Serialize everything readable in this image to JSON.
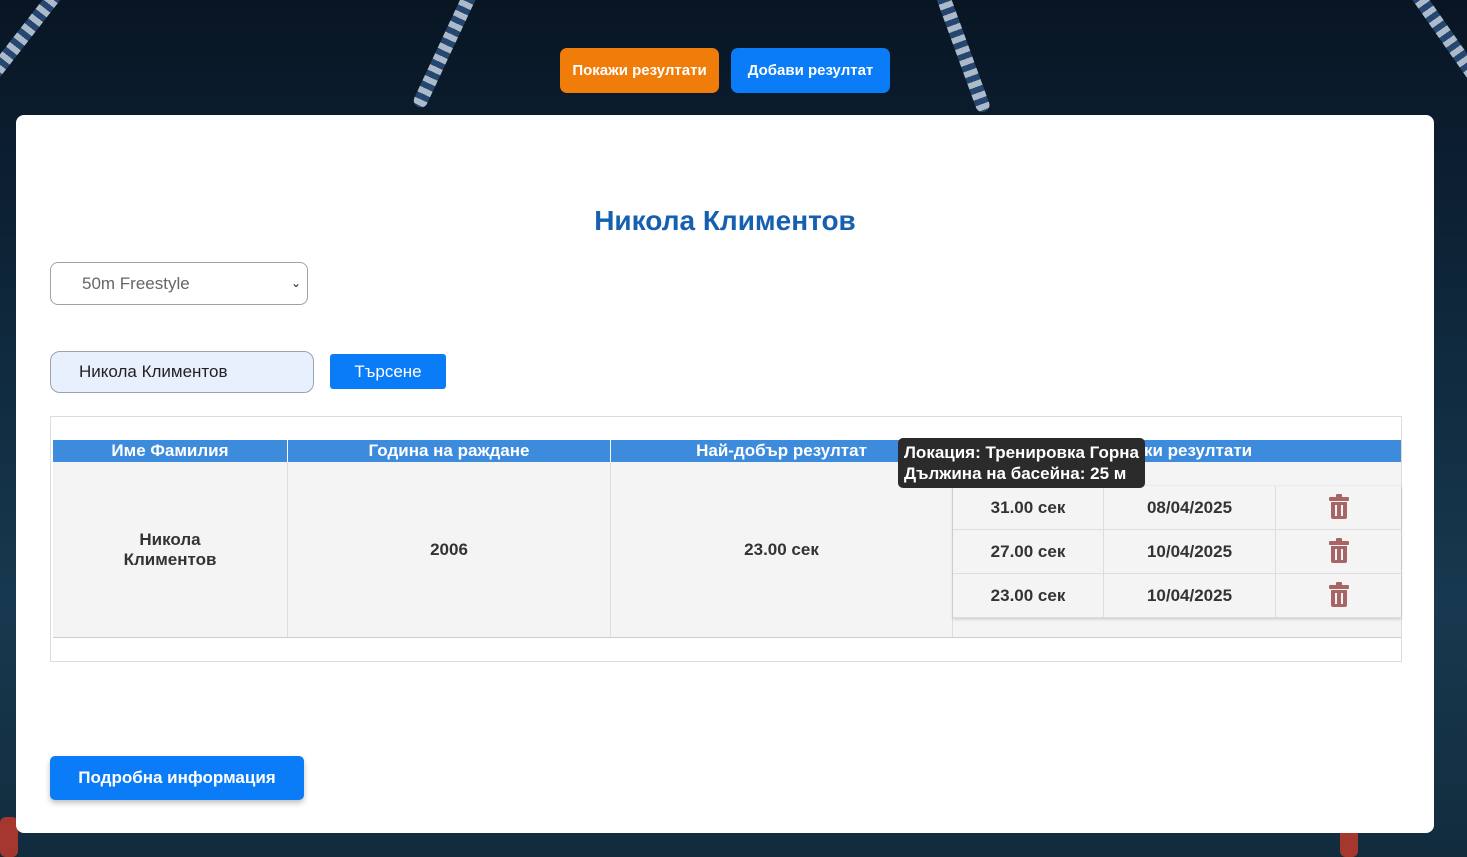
{
  "nav": {
    "show_results": "Покажи резултати",
    "add_result": "Добави резултат"
  },
  "athlete": {
    "title": "Никола Климентов"
  },
  "discipline_select": {
    "selected": "50m Freestyle"
  },
  "search": {
    "value": "Никола Климентов",
    "button": "Търсене"
  },
  "table": {
    "headers": [
      "Име Фамилия",
      "Година на раждане",
      "Най-добър резултат",
      "Всички резултати"
    ],
    "row": {
      "name": "Никола Климентов",
      "birth_year": "2006",
      "best": "23.00 сек",
      "results": [
        {
          "time": "31.00 сек",
          "date": "08/04/2025"
        },
        {
          "time": "27.00 сек",
          "date": "10/04/2025"
        },
        {
          "time": "23.00 сек",
          "date": "10/04/2025"
        }
      ]
    }
  },
  "tooltip": {
    "line1": "Локация: Тренировка Горна",
    "line2": "Дължина на басейна: 25 м"
  },
  "detail_button": "Подробна информация",
  "icons": {
    "delete": "trash-icon",
    "dropdown": "chevron-down-icon"
  },
  "colors": {
    "accent_blue": "#0a7cf7",
    "accent_orange": "#f07c0a",
    "header_blue": "#3d8bdc",
    "title_blue": "#1560b0"
  }
}
